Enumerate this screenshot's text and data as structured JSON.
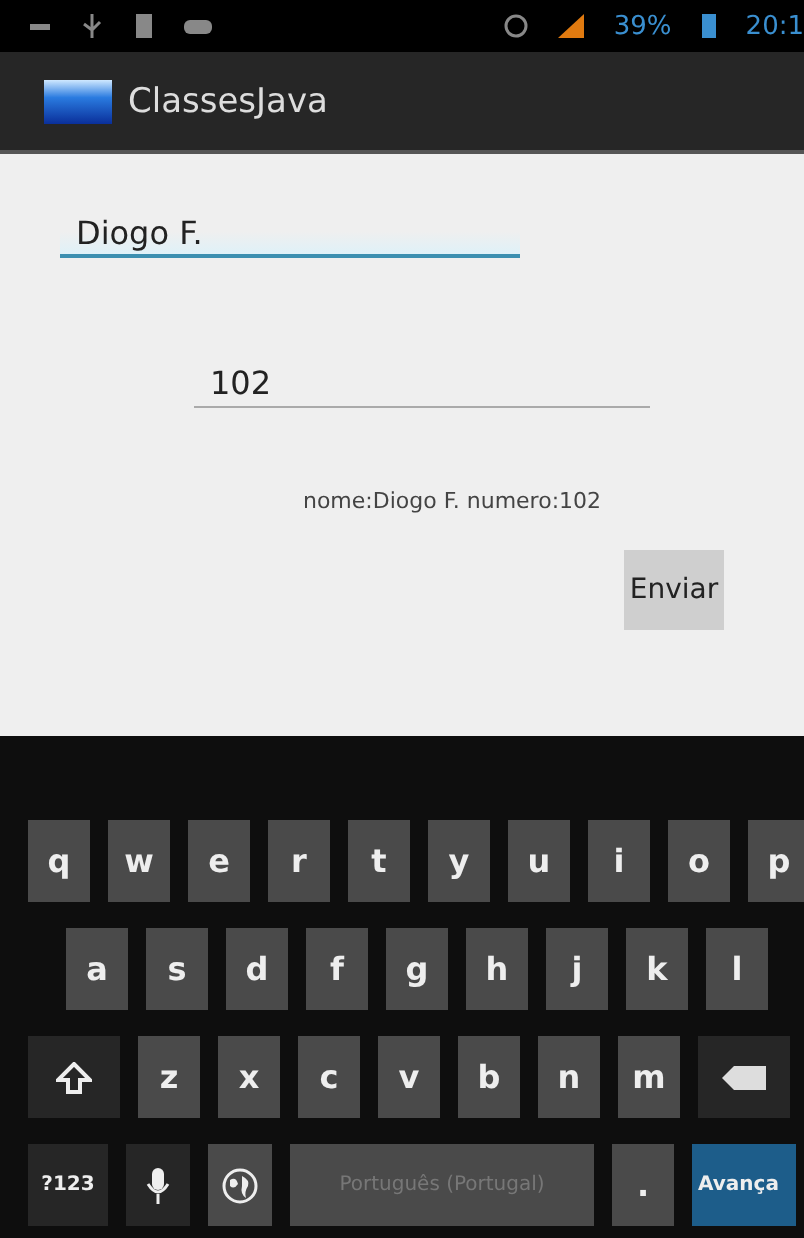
{
  "status_bar": {
    "battery": "39%",
    "time": "20:1"
  },
  "app_bar": {
    "title": "ClassesJava"
  },
  "fields": [
    {
      "value": "Diogo F.",
      "focused": true
    },
    {
      "value": "102",
      "focused": false
    }
  ],
  "result_text": "nome:Diogo F. numero:102",
  "submit_button": "Enviar",
  "keyboard": {
    "rows": [
      [
        {
          "kind": "letter",
          "label": "q"
        },
        {
          "kind": "letter",
          "label": "w"
        },
        {
          "kind": "letter",
          "label": "e"
        },
        {
          "kind": "letter",
          "label": "r"
        },
        {
          "kind": "letter",
          "label": "t"
        },
        {
          "kind": "letter",
          "label": "y"
        },
        {
          "kind": "letter",
          "label": "u"
        },
        {
          "kind": "letter",
          "label": "i"
        },
        {
          "kind": "letter",
          "label": "o"
        },
        {
          "kind": "letter",
          "label": "p"
        }
      ],
      [
        {
          "kind": "letter",
          "label": "a"
        },
        {
          "kind": "letter",
          "label": "s"
        },
        {
          "kind": "letter",
          "label": "d"
        },
        {
          "kind": "letter",
          "label": "f"
        },
        {
          "kind": "letter",
          "label": "g"
        },
        {
          "kind": "letter",
          "label": "h"
        },
        {
          "kind": "letter",
          "label": "j"
        },
        {
          "kind": "letter",
          "label": "k"
        },
        {
          "kind": "letter",
          "label": "l"
        }
      ],
      [
        {
          "kind": "shift"
        },
        {
          "kind": "letter",
          "label": "z"
        },
        {
          "kind": "letter",
          "label": "x"
        },
        {
          "kind": "letter",
          "label": "c"
        },
        {
          "kind": "letter",
          "label": "v"
        },
        {
          "kind": "letter",
          "label": "b"
        },
        {
          "kind": "letter",
          "label": "n"
        },
        {
          "kind": "letter",
          "label": "m"
        },
        {
          "kind": "backspace"
        }
      ],
      [
        {
          "kind": "symbols",
          "label": "?123"
        },
        {
          "kind": "mic"
        },
        {
          "kind": "globe"
        },
        {
          "kind": "space",
          "label": "Português (Portugal)"
        },
        {
          "kind": "letter",
          "label": "."
        },
        {
          "kind": "action",
          "label": "Avança"
        }
      ]
    ]
  }
}
